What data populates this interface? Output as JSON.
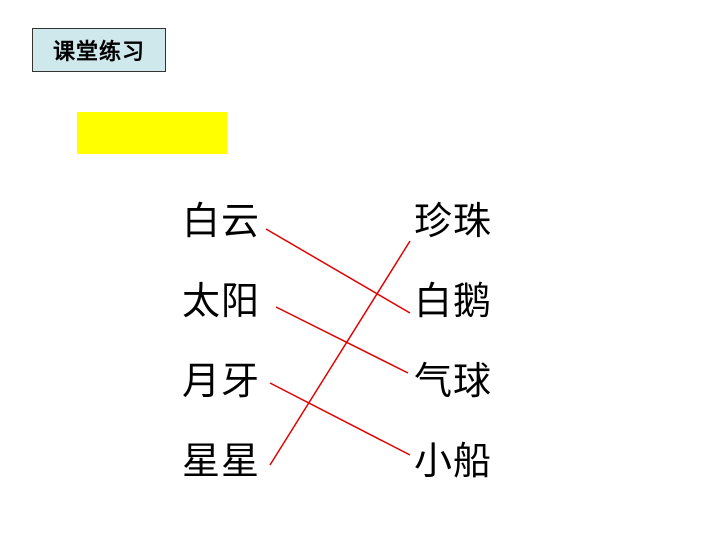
{
  "slide": {
    "title": "课堂练习",
    "line_color": "#e00000",
    "highlight_color": "#ffff00",
    "title_bg_color": "#cfe8ec"
  },
  "left_words": [
    "白云",
    "太阳",
    "月牙",
    "星星"
  ],
  "right_words": [
    "珍珠",
    "白鹅",
    "气球",
    "小船"
  ],
  "matches": [
    {
      "left": "白云",
      "right": "白鹅"
    },
    {
      "left": "太阳",
      "right": "气球"
    },
    {
      "left": "月牙",
      "right": "小船"
    },
    {
      "left": "星星",
      "right": "珍珠"
    }
  ]
}
